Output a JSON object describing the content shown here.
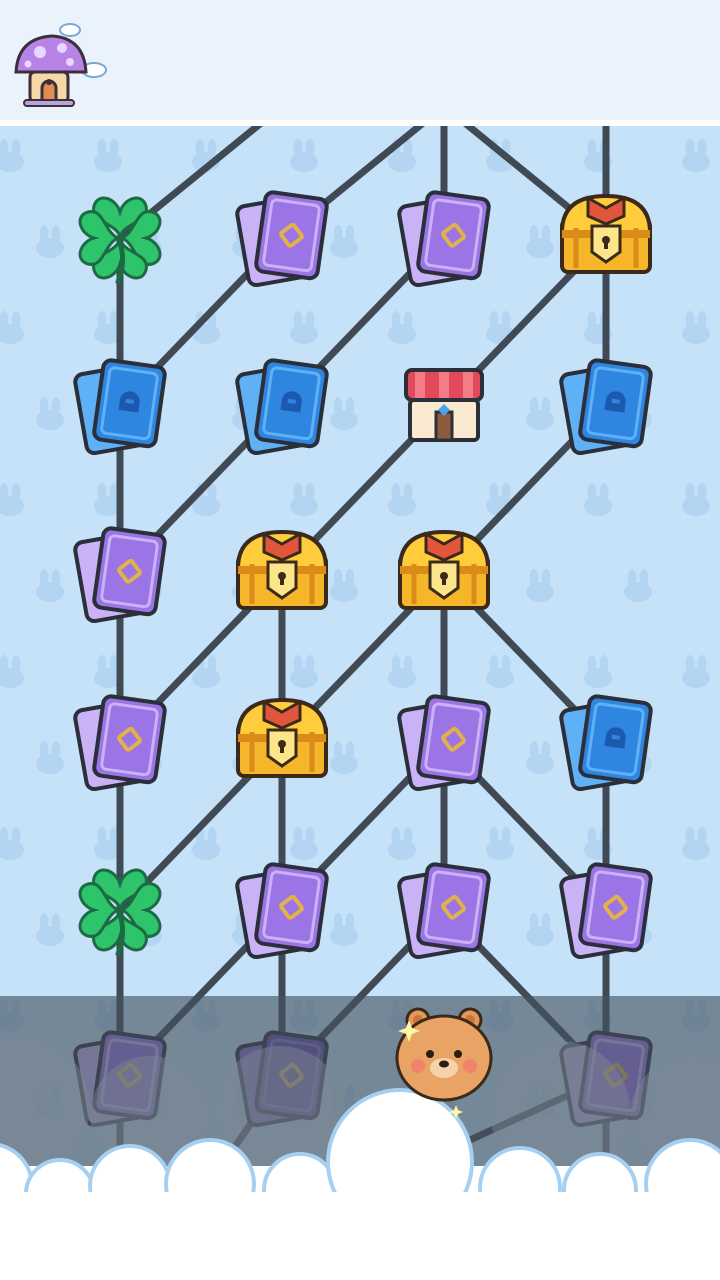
{
  "screen": "map",
  "colors": {
    "background": "#c6e2f9",
    "header": "#eaf3fb",
    "path": "#3f4a55",
    "fog": "#44505c",
    "card_purple": "#9b74e6",
    "card_blue": "#2f86e0",
    "chest_gold": "#f5b62a",
    "clover": "#2ec46c"
  },
  "header": {
    "home_button": {
      "icon": "mushroom-house-icon"
    }
  },
  "player": {
    "character": "bear",
    "row": 5,
    "col": 2
  },
  "map": {
    "rows": [
      [
        "clover",
        "card-purple",
        "card-purple",
        "chest"
      ],
      [
        "card-blue",
        "card-blue",
        "shop",
        "card-blue"
      ],
      [
        "card-purple",
        "chest",
        "chest",
        null
      ],
      [
        "card-purple",
        "chest",
        "card-purple",
        "card-blue"
      ],
      [
        "clover",
        "card-purple",
        "card-purple",
        "card-purple"
      ],
      [
        "card-purple",
        "card-dark",
        null,
        "card-purple"
      ]
    ],
    "fog_from_row": 6
  }
}
